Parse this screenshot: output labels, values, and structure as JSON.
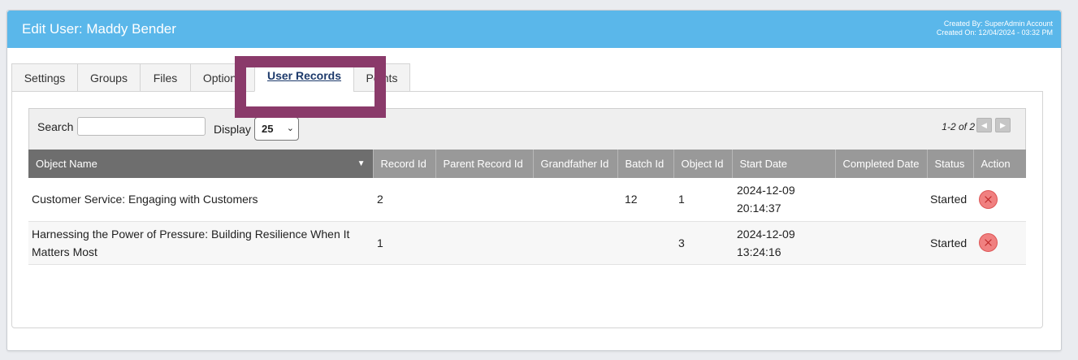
{
  "header": {
    "title": "Edit User: Maddy Bender",
    "created_by": "Created By: SuperAdmin Account",
    "created_on": "Created On: 12/04/2024 - 03:32 PM"
  },
  "tabs": [
    {
      "label": "Settings",
      "active": false
    },
    {
      "label": "Groups",
      "active": false
    },
    {
      "label": "Files",
      "active": false
    },
    {
      "label": "Options",
      "active": false
    },
    {
      "label": "User Records",
      "active": true
    },
    {
      "label": "Points",
      "active": false
    }
  ],
  "toolbar": {
    "search_label": "Search",
    "search_value": "",
    "display_label": "Display",
    "display_value": "25",
    "pager_text": "1-2 of 2"
  },
  "table": {
    "columns": [
      "Object Name",
      "Record Id",
      "Parent Record Id",
      "Grandfather Id",
      "Batch Id",
      "Object Id",
      "Start Date",
      "Completed Date",
      "Status",
      "Action"
    ],
    "rows": [
      {
        "object_name": "Customer Service: Engaging with Customers",
        "record_id": "2",
        "parent_record_id": "",
        "grandfather_id": "",
        "batch_id": "12",
        "object_id": "1",
        "start_date": "2024-12-09",
        "start_time": "20:14:37",
        "completed_date": "",
        "status": "Started"
      },
      {
        "object_name": "Harnessing the Power of Pressure: Building Resilience When It Matters Most",
        "record_id": "1",
        "parent_record_id": "",
        "grandfather_id": "",
        "batch_id": "",
        "object_id": "3",
        "start_date": "2024-12-09",
        "start_time": "13:24:16",
        "completed_date": "",
        "status": "Started"
      }
    ]
  },
  "colors": {
    "header_bg": "#5ab7ea",
    "highlight_border": "#8a3a6a",
    "active_tab_text": "#1d3a6b",
    "cancel_button": "#f08080"
  },
  "icons": {
    "sort": "triangle-down-icon",
    "pager_prev": "triangle-left-icon",
    "pager_next": "triangle-right-icon",
    "cancel": "cancel-circle-icon"
  }
}
